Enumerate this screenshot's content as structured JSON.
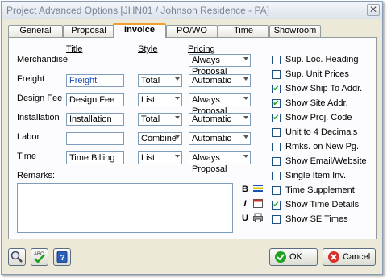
{
  "window": {
    "title": "Project Advanced Options [JHN01 / Johnson Residence - PA]",
    "close_glyph": "✕"
  },
  "tabs": [
    "General",
    "Proposal",
    "Invoice",
    "PO/WO",
    "Time",
    "Showroom"
  ],
  "columns": {
    "title": "Title",
    "style": "Style",
    "pricing": "Pricing"
  },
  "rows": [
    {
      "label": "Merchandise",
      "title": null,
      "style": null,
      "pricing": "Always Proposal"
    },
    {
      "label": "Freight",
      "title": "Freight",
      "style": "Total",
      "pricing": "Automatic"
    },
    {
      "label": "Design Fee",
      "title": "Design Fee",
      "style": "List",
      "pricing": "Always Proposal"
    },
    {
      "label": "Installation",
      "title": "Installation",
      "style": "Total",
      "pricing": "Automatic"
    },
    {
      "label": "Labor",
      "title": "",
      "style": "Combine",
      "pricing": "Automatic"
    },
    {
      "label": "Time",
      "title": "Time Billing",
      "style": "List",
      "pricing": "Always Proposal"
    }
  ],
  "options": [
    {
      "label": "Sup. Loc. Heading",
      "checked": false
    },
    {
      "label": "Sup. Unit Prices",
      "checked": false
    },
    {
      "label": "Show Ship To Addr.",
      "checked": true
    },
    {
      "label": "Show Site Addr.",
      "checked": true
    },
    {
      "label": "Show Proj. Code",
      "checked": true
    },
    {
      "label": "Unit to 4 Decimals",
      "checked": false
    },
    {
      "label": "Rmks. on New Pg.",
      "checked": false
    },
    {
      "label": "Show Email/Website",
      "checked": false
    },
    {
      "label": "Single Item Inv.",
      "checked": false
    },
    {
      "label": "Time Supplement",
      "checked": false
    },
    {
      "label": "Show Time Details",
      "checked": true
    },
    {
      "label": "Show SE Times",
      "checked": false
    }
  ],
  "remarks": {
    "label": "Remarks:",
    "value": ""
  },
  "format_buttons": {
    "bold": "B",
    "italic": "I",
    "underline": "U"
  },
  "footer": {
    "ok_label": "OK",
    "cancel_label": "Cancel"
  },
  "colors": {
    "accent_tab": "#f0a02f",
    "check_green": "#21a121",
    "cancel_red": "#d6322b"
  }
}
